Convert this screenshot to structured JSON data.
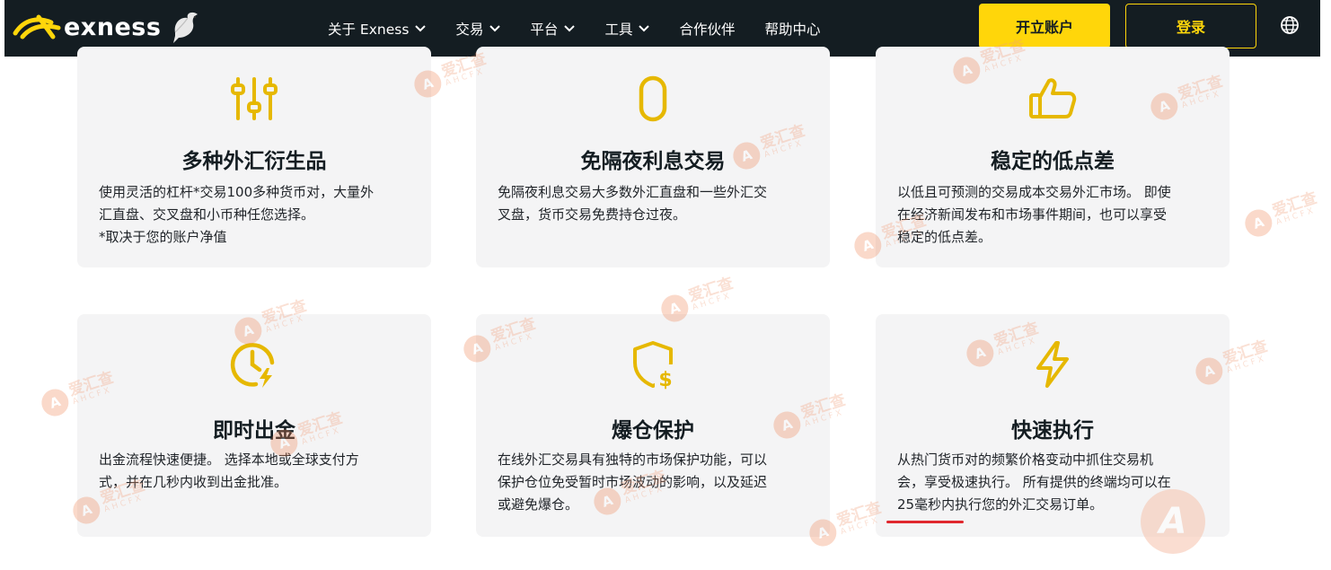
{
  "header": {
    "brand": "exness",
    "nav": [
      {
        "label": "关于 Exness",
        "has_dropdown": true
      },
      {
        "label": "交易",
        "has_dropdown": true
      },
      {
        "label": "平台",
        "has_dropdown": true
      },
      {
        "label": "工具",
        "has_dropdown": true
      },
      {
        "label": "合作伙伴",
        "has_dropdown": false
      },
      {
        "label": "帮助中心",
        "has_dropdown": false
      }
    ],
    "open_account": "开立账户",
    "login": "登录",
    "globe_icon": "globe-icon"
  },
  "colors": {
    "header_bg": "#141d22",
    "accent": "#ffd60a",
    "card_bg": "#f4f4f5",
    "icon_color": "#e6b800",
    "underline": "#e0282e"
  },
  "features": [
    {
      "icon": "sliders-icon",
      "title": "多种外汇衍生品",
      "lines": [
        "使用灵活的杠杆*交易100多种货币对，大量外",
        "汇直盘、交叉盘和小币种任您选择。",
        "*取决于您的账户净值"
      ]
    },
    {
      "icon": "zero-icon",
      "title": "免隔夜利息交易",
      "lines": [
        "免隔夜利息交易大多数外汇直盘和一些外汇交",
        "叉盘，货币交易免费持仓过夜。"
      ]
    },
    {
      "icon": "thumbs-up-icon",
      "title": "稳定的低点差",
      "lines": [
        "以低且可预测的交易成本交易外汇市场。 即使",
        "在经济新闻发布和市场事件期间，也可以享受",
        "稳定的低点差。"
      ]
    },
    {
      "icon": "clock-lightning-icon",
      "title": "即时出金",
      "lines": [
        "出金流程快速便捷。 选择本地或全球支付方",
        "式，并在几秒内收到出金批准。"
      ]
    },
    {
      "icon": "shield-dollar-icon",
      "title": "爆仓保护",
      "lines": [
        "在线外汇交易具有独特的市场保护功能，可以",
        "保护仓位免受暂时市场波动的影响，以及延迟",
        "或避免爆仓。"
      ]
    },
    {
      "icon": "lightning-icon",
      "title": "快速执行",
      "lines": [
        "从热门货币对的频繁价格变动中抓住交易机",
        "会，享受极速执行。 所有提供的终端均可以在",
        "25毫秒内执行您的外汇交易订单。"
      ]
    }
  ],
  "watermark": {
    "cn": "爱汇查",
    "en": "AHCFX"
  }
}
